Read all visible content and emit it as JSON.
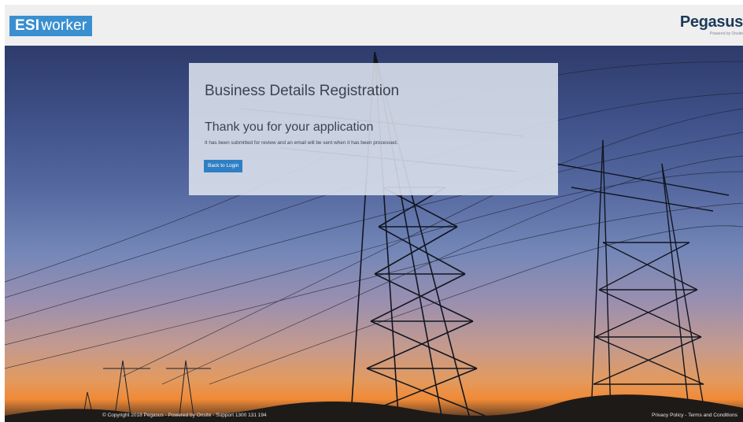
{
  "header": {
    "logo_strong": "ESI",
    "logo_light": "worker",
    "brand": "Pegasus",
    "brand_sub": "Powered by Onsite"
  },
  "card": {
    "title": "Business Details Registration",
    "subtitle": "Thank you for your application",
    "message": "It has been submitted for review and an email will be sent when it has been processed.",
    "button_label": "Back to Login"
  },
  "footer": {
    "copyright": "© Copyright 2018 Pegasus - Powered by Onsite - Support 1300 131 194",
    "privacy_label": "Privacy Policy",
    "separator": " - ",
    "terms_label": "Terms and Conditions"
  },
  "colors": {
    "logo_bg": "#3a8fd0",
    "button_bg": "#2f7fc4",
    "brand_text": "#1b3a5b",
    "header_bg": "#efefef"
  }
}
